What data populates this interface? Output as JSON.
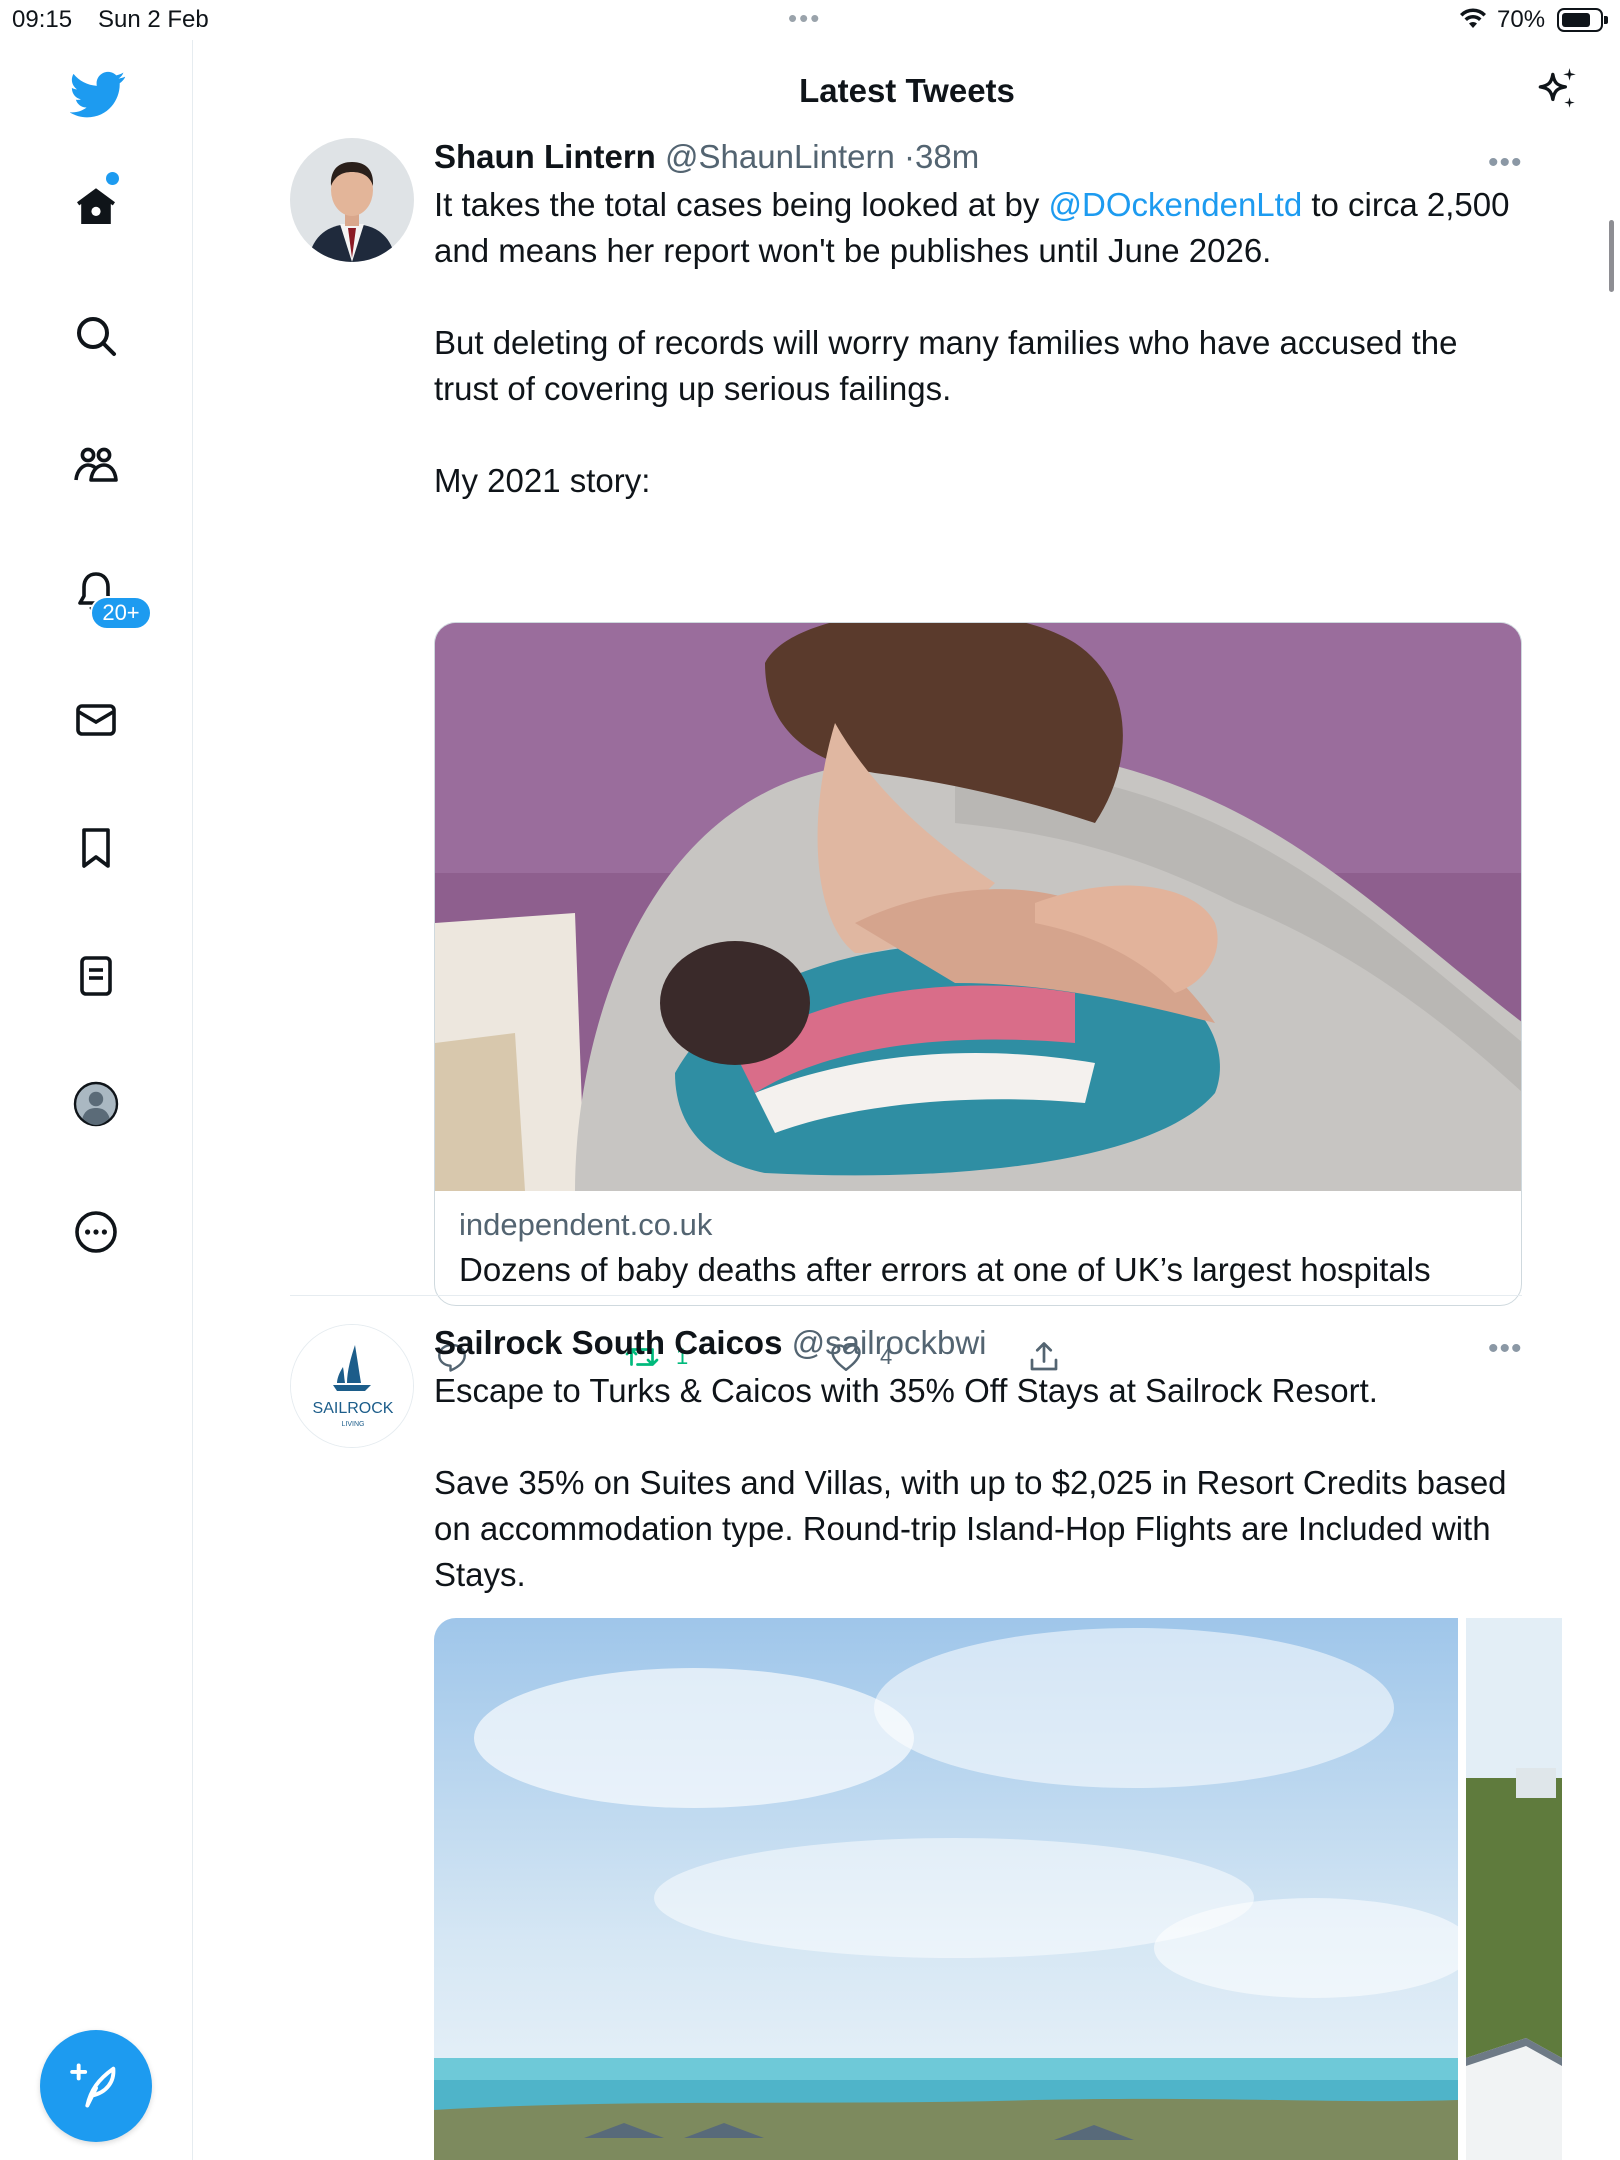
{
  "status_bar": {
    "time": "09:15",
    "date": "Sun 2 Feb",
    "battery": "70%",
    "dots": "•••"
  },
  "sidebar": {
    "items": [
      {
        "name": "home"
      },
      {
        "name": "explore"
      },
      {
        "name": "communities"
      },
      {
        "name": "notifications"
      },
      {
        "name": "messages"
      },
      {
        "name": "bookmarks"
      },
      {
        "name": "lists"
      },
      {
        "name": "profile"
      },
      {
        "name": "more"
      }
    ],
    "notifications_badge": "20+"
  },
  "header": {
    "title": "Latest Tweets"
  },
  "tweets": [
    {
      "name": "Shaun Lintern",
      "handle": "@ShaunLintern",
      "sep": "·",
      "time": "38m",
      "more": "•••",
      "text_before_mention": "It takes the total cases being looked at by ",
      "mention": "@DOckendenLtd",
      "text_after_mention": " to circa 2,500 and means her report won't be publishes until June 2026.",
      "paragraph_2": "But deleting of records will worry many families who have accused the trust of covering up serious failings.",
      "paragraph_3": "My 2021 story:",
      "card": {
        "domain": "independent.co.uk",
        "title": "Dozens of baby deaths after errors at one of UK’s largest hospitals"
      },
      "retweets": "1",
      "likes": "4"
    },
    {
      "name": "Sailrock South Caicos",
      "handle": "@sailrockbwi",
      "more": "•••",
      "avatar_text": "SAILROCK",
      "avatar_subtext": "LIVING",
      "paragraph_1": "Escape to Turks & Caicos with 35% Off Stays at Sailrock Resort.",
      "paragraph_2": "Save 35% on Suites and Villas, with up to $2,025 in Resort Credits based on accommodation type. Round-trip Island-Hop Flights are Included with Stays."
    }
  ],
  "colors": {
    "accent": "#1d9bf0",
    "retweet_green": "#00ba7c",
    "muted_text": "#536471"
  }
}
